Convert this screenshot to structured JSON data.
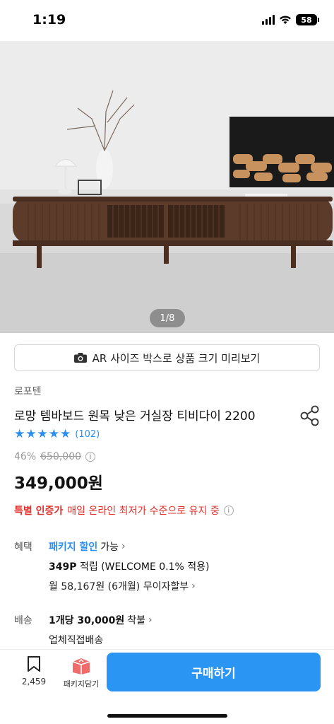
{
  "status_bar": {
    "time": "1:19",
    "battery": "58"
  },
  "gallery": {
    "pager": "1/8"
  },
  "ar_button": {
    "label": "AR 사이즈 박스로 상품 크기 미리보기"
  },
  "product": {
    "brand": "로포텐",
    "title": "로망 템바보드 원목 낮은 거실장 티비다이 2200",
    "rating": 5,
    "review_count": "(102)",
    "discount": "46%",
    "original_price": "650,000",
    "price": "349,000원"
  },
  "special": {
    "label": "특별 인증가",
    "text": "매일 온라인 최저가 수준으로 유지 중"
  },
  "benefits": {
    "label": "혜택",
    "package_text": "패키지 할인",
    "package_suffix": "가능",
    "points_value": "349P",
    "points_text": "적립 (WELCOME 0.1% 적용)",
    "installment": "월 58,167원 (6개월) 무이자할부"
  },
  "shipping": {
    "label": "배송",
    "fee_value": "1개당 30,000원",
    "fee_suffix": "착불",
    "method": "업체직접배송"
  },
  "bottom_bar": {
    "bookmark_count": "2,459",
    "package_label": "패키지담기",
    "buy_label": "구매하기"
  },
  "colors": {
    "accent": "#2a95f2",
    "link_blue": "#2a8ff0",
    "special_red": "#e0302a"
  },
  "icons": [
    "camera-icon",
    "share-icon",
    "star-icon",
    "info-icon",
    "chevron-right-icon",
    "bookmark-icon",
    "package-box-icon"
  ]
}
